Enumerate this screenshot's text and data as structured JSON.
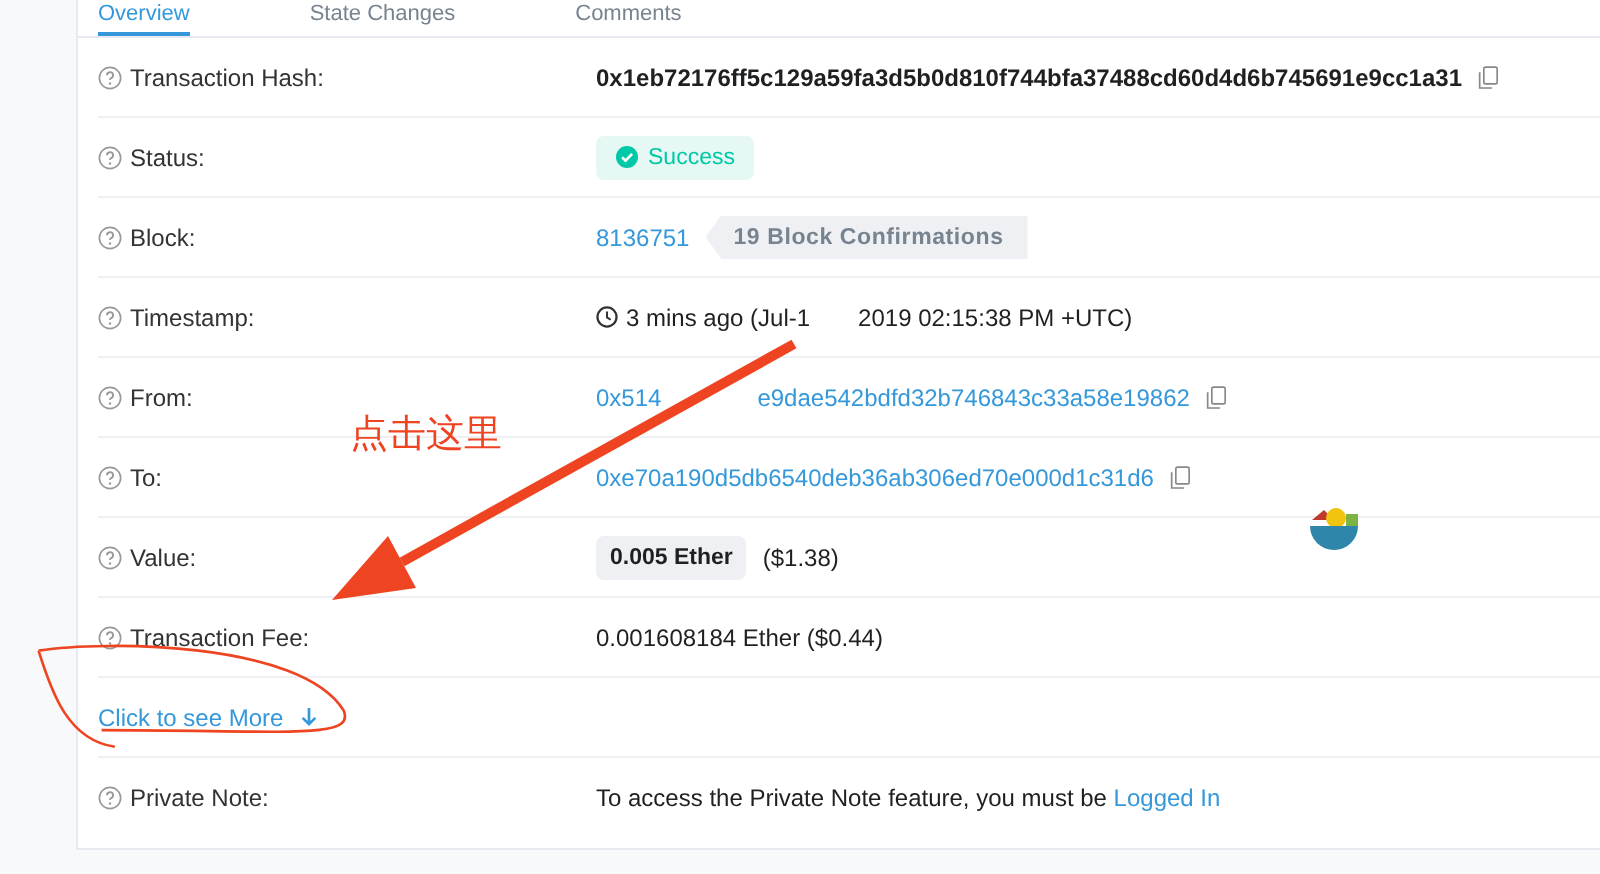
{
  "tabs": [
    {
      "label": "Overview",
      "selected": true
    },
    {
      "label": "State Changes",
      "selected": false
    },
    {
      "label": "Comments",
      "selected": false
    }
  ],
  "rows": [
    {
      "kind": "hash",
      "label": "Transaction Hash:",
      "value": "0x1eb72176ff5c129a59fa3d5b0d810f744bfa37488cd60d4d6b745691e9cc1a31"
    },
    {
      "kind": "status",
      "label": "Status:",
      "value": "Success"
    },
    {
      "kind": "block",
      "label": "Block:",
      "value": "8136751",
      "tag": "19 Block Confirmations"
    },
    {
      "kind": "time",
      "label": "Timestamp:",
      "parts": [
        "3 mins ago (Jul-1",
        "2019 02:15:38 PM +UTC)"
      ]
    },
    {
      "kind": "address",
      "label": "From:",
      "parts": [
        "0x514",
        "e9dae542bdfd32b746843c33a58e19862"
      ]
    },
    {
      "kind": "address",
      "label": "To:",
      "parts": [
        "0xe70a190d5db6540deb36ab306ed70e000d1c31d6"
      ]
    },
    {
      "kind": "value",
      "label": "Value:",
      "pill": "0.005 Ether",
      "value": "($1.38)"
    },
    {
      "kind": "plain",
      "label": "Transaction Fee:",
      "value": "0.001608184 Ether ($0.44)"
    },
    {
      "kind": "more",
      "link": "Click to see More"
    },
    {
      "kind": "note",
      "label": "Private Note:",
      "text": "To access the Private Note feature, you must be ",
      "link": "Logged In"
    }
  ],
  "annotation": {
    "text": "点击这里"
  }
}
